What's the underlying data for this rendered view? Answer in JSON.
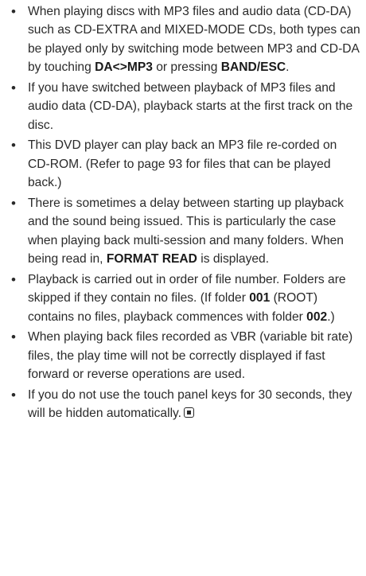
{
  "notes": [
    {
      "parts": [
        {
          "text": "When playing discs with MP3 files and audio data (CD-DA) such as CD-EXTRA and MIXED-MODE CDs, both types can be played only by switching mode between MP3 and CD-DA by touching "
        },
        {
          "text": "DA<>MP3",
          "bold": true
        },
        {
          "text": " or pressing "
        },
        {
          "text": "BAND/ESC",
          "bold": true
        },
        {
          "text": "."
        }
      ]
    },
    {
      "parts": [
        {
          "text": "If you have switched between playback of MP3 files and audio data (CD-DA), playback starts at the first track on the disc."
        }
      ]
    },
    {
      "parts": [
        {
          "text": "This DVD player can play back an MP3 file re-corded on CD-ROM. (Refer to page 93 for files that can be played back.)"
        }
      ]
    },
    {
      "parts": [
        {
          "text": "There is sometimes a delay between starting up playback and the sound being issued. This is particularly the case when playing back multi-session and many folders. When being read in, "
        },
        {
          "text": "FORMAT READ",
          "bold": true
        },
        {
          "text": " is displayed."
        }
      ]
    },
    {
      "parts": [
        {
          "text": "Playback is carried out in order of file number. Folders are skipped if they contain no files. (If folder "
        },
        {
          "text": "001",
          "bold": true
        },
        {
          "text": " (ROOT) contains no files, playback commences with folder "
        },
        {
          "text": "002",
          "bold": true
        },
        {
          "text": ".)"
        }
      ]
    },
    {
      "parts": [
        {
          "text": "When playing back files recorded as VBR (variable bit rate) files, the play time will not be correctly displayed if fast forward or reverse operations are used."
        }
      ]
    },
    {
      "parts": [
        {
          "text": "If you do not use the touch panel keys for 30 seconds, they will be hidden automatically."
        }
      ],
      "end_mark_icon": "end-of-section-icon"
    }
  ]
}
